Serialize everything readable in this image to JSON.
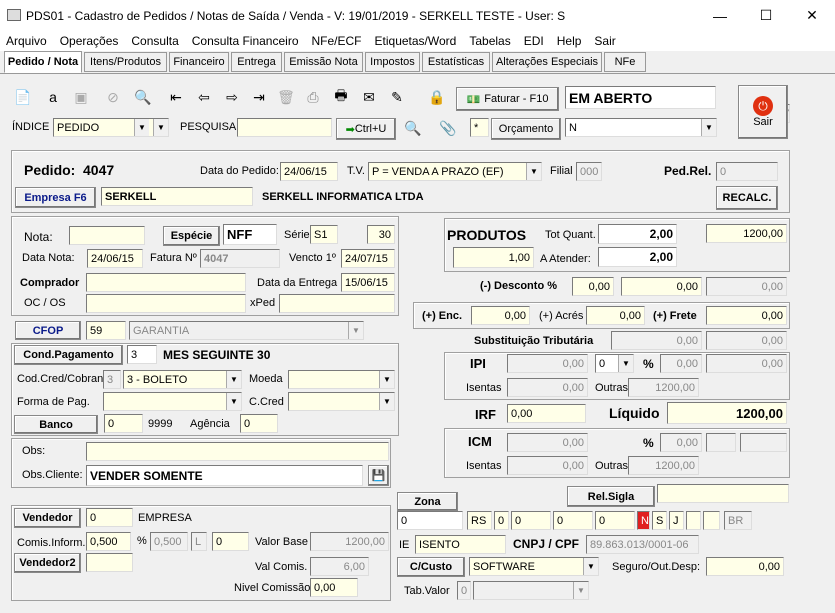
{
  "window": {
    "title": "PDS01 - Cadastro de Pedidos / Notas de Saída / Venda - V: 19/01/2019 - SERKELL TESTE - User: S",
    "min": "—",
    "max": "☐",
    "close": "✕"
  },
  "menu": [
    "Arquivo",
    "Operações",
    "Consulta",
    "Consulta Financeiro",
    "NFe/ECF",
    "Etiquetas/Word",
    "Tabelas",
    "EDI",
    "Help",
    "Sair"
  ],
  "tabs": [
    "Pedido / Nota",
    "Itens/Produtos",
    "Financeiro",
    "Entrega",
    "Emissão Nota",
    "Impostos",
    "Estatísticas",
    "Alterações Especiais",
    "NFe"
  ],
  "tab_code": "4047",
  "toolbar": {
    "faturar": "Faturar - F10",
    "status": "EM ABERTO",
    "sair": "Sair"
  },
  "search": {
    "indice_label": "ÍNDICE",
    "indice_value": "PEDIDO",
    "pesquisa_label": "PESQUISA",
    "ctrlu": "Ctrl+U",
    "star": "*",
    "orcamento": "Orçamento",
    "n_value": "N"
  },
  "pedido": {
    "label": "Pedido:",
    "number": "4047",
    "data_label": "Data do Pedido:",
    "data": "24/06/15",
    "tv_label": "T.V.",
    "tv": "P = VENDA A PRAZO (EF)",
    "filial_label": "Filial",
    "filial": "000",
    "pedrel_label": "Ped.Rel.",
    "pedrel": "0",
    "empresa_btn": "Empresa F6",
    "empresa_code": "SERKELL",
    "empresa_name": "SERKELL INFORMATICA LTDA",
    "recalc": "RECALC."
  },
  "nota": {
    "nota_label": "Nota:",
    "especie_btn": "Espécie",
    "especie": "NFF",
    "serie_label": "Série",
    "serie": "S1",
    "num30": "30",
    "datanota_label": "Data Nota:",
    "datanota": "24/06/15",
    "fatura_label": "Fatura Nº",
    "fatura": "4047",
    "vencto_label": "Vencto 1º",
    "vencto": "24/07/15",
    "comprador_label": "Comprador",
    "entrega_label": "Data da Entrega",
    "entrega": "15/06/15",
    "ocos_label": "OC / OS",
    "xped_label": "xPed"
  },
  "cfop": {
    "btn": "CFOP",
    "code": "59",
    "desc": "GARANTIA"
  },
  "cond": {
    "btn": "Cond.Pagamento",
    "code": "3",
    "desc": "MES SEGUINTE 30",
    "codcred_label": "Cod.Cred/Cobran",
    "codcred": "3",
    "boleto": "3 - BOLETO",
    "moeda_label": "Moeda",
    "formapag_label": "Forma de Pag.",
    "ccred_label": "C.Cred",
    "banco_btn": "Banco",
    "banco": "0",
    "banco_num": "9999",
    "agencia_label": "Agência",
    "agencia": "0"
  },
  "obs": {
    "obs_label": "Obs:",
    "obscli_label": "Obs.Cliente:",
    "obscli": "VENDER SOMENTE"
  },
  "vendedor": {
    "btn": "Vendedor",
    "code": "0",
    "empresa": "EMPRESA",
    "comis_label": "Comis.Inform.",
    "comis": "0,500",
    "pct": "%",
    "comis2": "0,500",
    "l": "L",
    "zero": "0",
    "valbase_label": "Valor Base",
    "valbase": "1200,00",
    "vendedor2_btn": "Vendedor2",
    "valcomis_label": "Val Comis.",
    "valcomis": "6,00",
    "nivel_label": "Nivel Comissão",
    "nivel": "0,00"
  },
  "produtos": {
    "label": "PRODUTOS",
    "totquant_label": "Tot Quant.",
    "totquant": "2,00",
    "total": "1200,00",
    "one": "1,00",
    "atender_label": "A Atender:",
    "atender": "2,00",
    "desconto_label": "(-) Desconto %",
    "desc1": "0,00",
    "desc2": "0,00",
    "desc3": "0,00",
    "enc_label": "(+) Enc.",
    "enc": "0,00",
    "acres_label": "(+) Acrés",
    "acres": "0,00",
    "frete_label": "(+) Frete",
    "frete": "0,00",
    "subst_label": "Substituição Tributária",
    "subst1": "0,00",
    "subst2": "0,00",
    "ipi_label": "IPI",
    "ipi1": "0,00",
    "ipi_sel": "0",
    "ipi_pct": "%",
    "ipi2": "0,00",
    "ipi3": "0,00",
    "isentas_label": "Isentas",
    "isentas": "0,00",
    "outras_label": "Outras",
    "outras": "1200,00",
    "irf_label": "IRF",
    "irf": "0,00",
    "liquido_label": "Líquido",
    "liquido": "1200,00",
    "icm_label": "ICM",
    "icm1": "0,00",
    "icm_pct": "%",
    "icm2": "0,00",
    "icm_isentas": "0,00",
    "icm_outras": "1200,00"
  },
  "zona": {
    "btn": "Zona",
    "code": "0",
    "rs": "RS",
    "z1": "0",
    "z2": "0",
    "z3": "0",
    "z4": "0",
    "n": "N",
    "s": "S",
    "j": "J",
    "br": "BR",
    "relsigla": "Rel.Sigla",
    "ie_label": "IE",
    "ie": "ISENTO",
    "cnpj_label": "CNPJ / CPF",
    "cnpj": "89.863.013/0001-06",
    "ccusto_btn": "C/Custo",
    "ccusto": "SOFTWARE",
    "seguro_label": "Seguro/Out.Desp:",
    "seguro": "0,00",
    "tabvalor_label": "Tab.Valor",
    "tabvalor": "0"
  },
  "icons": [
    "new-doc-icon",
    "spell-icon",
    "save-icon",
    "cancel-icon",
    "search-icon",
    "first-icon",
    "prev-icon",
    "next-icon",
    "last-icon",
    "delete-icon",
    "print-icon",
    "printer2-icon",
    "mail-icon",
    "edit-icon",
    "lock-icon",
    "money-icon",
    "power-icon",
    "paperclip-icon",
    "disk-icon"
  ]
}
